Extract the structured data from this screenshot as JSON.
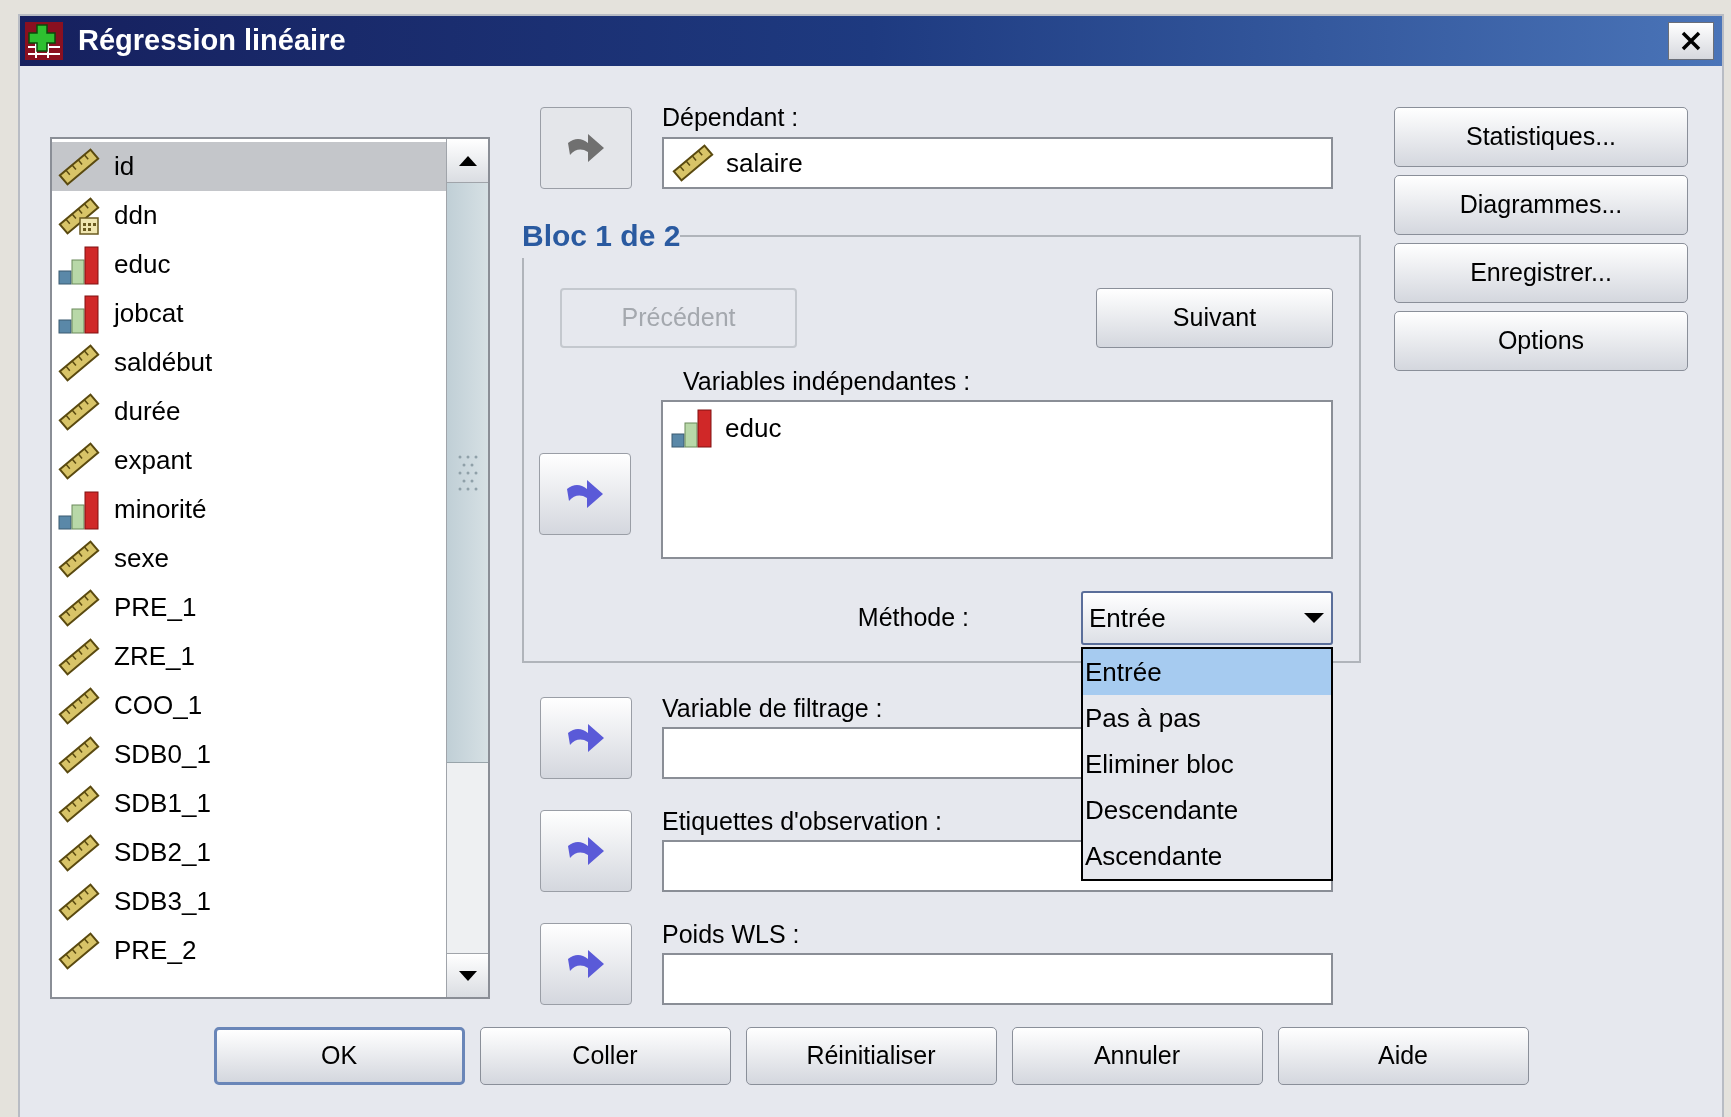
{
  "window": {
    "title": "Régression linéaire"
  },
  "variables": [
    {
      "name": "id",
      "kind": "scale",
      "selected": true
    },
    {
      "name": "ddn",
      "kind": "date",
      "selected": false
    },
    {
      "name": "educ",
      "kind": "ordinal",
      "selected": false
    },
    {
      "name": "jobcat",
      "kind": "ordinal",
      "selected": false
    },
    {
      "name": "saldébut",
      "kind": "scale",
      "selected": false
    },
    {
      "name": "durée",
      "kind": "scale",
      "selected": false
    },
    {
      "name": "expant",
      "kind": "scale",
      "selected": false
    },
    {
      "name": "minorité",
      "kind": "ordinal",
      "selected": false
    },
    {
      "name": "sexe",
      "kind": "scale",
      "selected": false
    },
    {
      "name": "PRE_1",
      "kind": "scale",
      "selected": false
    },
    {
      "name": "ZRE_1",
      "kind": "scale",
      "selected": false
    },
    {
      "name": "COO_1",
      "kind": "scale",
      "selected": false
    },
    {
      "name": "SDB0_1",
      "kind": "scale",
      "selected": false
    },
    {
      "name": "SDB1_1",
      "kind": "scale",
      "selected": false
    },
    {
      "name": "SDB2_1",
      "kind": "scale",
      "selected": false
    },
    {
      "name": "SDB3_1",
      "kind": "scale",
      "selected": false
    },
    {
      "name": "PRE_2",
      "kind": "scale",
      "selected": false
    }
  ],
  "dependent": {
    "label": "Dépendant :",
    "value": "salaire",
    "kind": "scale",
    "arrow_disabled": true
  },
  "block": {
    "title": "Bloc 1 de 2",
    "previous": {
      "label": "Précédent",
      "disabled": true
    },
    "next": {
      "label": "Suivant",
      "disabled": false
    },
    "independents_label": "Variables indépendantes :",
    "arrow_disabled": false,
    "independents": [
      {
        "name": "educ",
        "kind": "ordinal"
      }
    ],
    "method_label": "Méthode :",
    "method": {
      "value": "Entrée",
      "expanded": true,
      "options": [
        {
          "label": "Entrée",
          "selected": true
        },
        {
          "label": "Pas à pas",
          "selected": false
        },
        {
          "label": "Eliminer bloc",
          "selected": false
        },
        {
          "label": "Descendante",
          "selected": false
        },
        {
          "label": "Ascendante",
          "selected": false
        }
      ]
    }
  },
  "target_fields": [
    {
      "label": "Variable de filtrage :",
      "arrow_disabled": false
    },
    {
      "label": "Etiquettes d'observation :",
      "arrow_disabled": false
    },
    {
      "label": "Poids WLS :",
      "arrow_disabled": false
    }
  ],
  "side_buttons": [
    "Statistiques...",
    "Diagrammes...",
    "Enregistrer...",
    "Options"
  ],
  "buttons": [
    {
      "label": "OK",
      "default": true
    },
    {
      "label": "Coller",
      "default": false
    },
    {
      "label": "Réinitialiser",
      "default": false
    },
    {
      "label": "Annuler",
      "default": false
    },
    {
      "label": "Aide",
      "default": false
    }
  ]
}
